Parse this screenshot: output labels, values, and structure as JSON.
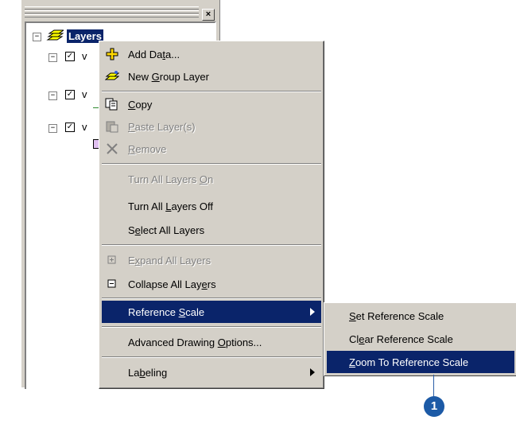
{
  "toc": {
    "close_glyph": "×",
    "root_label": "Layers",
    "root_expander": "−",
    "layers": [
      {
        "expander": "−",
        "check": "✓",
        "label": "v"
      },
      {
        "expander": "−",
        "check": "✓",
        "label": "v"
      },
      {
        "expander": "−",
        "check": "✓",
        "label": "v"
      }
    ]
  },
  "menu": {
    "items": [
      {
        "id": "add-data",
        "label_pre": "Add Da",
        "label_u": "t",
        "label_post": "a...",
        "icon": "add-data-icon",
        "disabled": false
      },
      {
        "id": "new-group-layer",
        "label_pre": "New ",
        "label_u": "G",
        "label_post": "roup Layer",
        "icon": "new-group-layer-icon",
        "disabled": false
      },
      {
        "id": "copy",
        "label_pre": "",
        "label_u": "C",
        "label_post": "opy",
        "icon": "copy-icon",
        "disabled": false
      },
      {
        "id": "paste-layers",
        "label_pre": "",
        "label_u": "P",
        "label_post": "aste Layer(s)",
        "icon": "paste-icon",
        "disabled": true
      },
      {
        "id": "remove",
        "label_pre": "",
        "label_u": "R",
        "label_post": "emove",
        "icon": "remove-icon",
        "disabled": true
      },
      {
        "id": "turn-all-layers-on",
        "label_pre": "Turn All Layers ",
        "label_u": "O",
        "label_post": "n",
        "disabled": true
      },
      {
        "id": "turn-all-layers-off",
        "label_pre": "Turn All ",
        "label_u": "L",
        "label_post": "ayers Off",
        "disabled": false
      },
      {
        "id": "select-all-layers",
        "label_pre": "S",
        "label_u": "e",
        "label_post": "lect All Layers",
        "disabled": false
      },
      {
        "id": "expand-all-layers",
        "label_pre": "E",
        "label_u": "x",
        "label_post": "pand All Layers",
        "icon": "expand-icon",
        "disabled": true
      },
      {
        "id": "collapse-all-layers",
        "label_pre": "Collapse All Lay",
        "label_u": "e",
        "label_post": "rs",
        "icon": "collapse-icon",
        "disabled": false
      },
      {
        "id": "reference-scale",
        "label_pre": "Reference ",
        "label_u": "S",
        "label_post": "cale",
        "highlighted": true,
        "submenu": true
      },
      {
        "id": "advanced-drawing-options",
        "label_pre": "Advanced Drawing ",
        "label_u": "O",
        "label_post": "ptions...",
        "disabled": false
      },
      {
        "id": "labeling",
        "label_pre": "La",
        "label_u": "b",
        "label_post": "eling",
        "submenu": true,
        "disabled": false
      }
    ]
  },
  "submenu": {
    "items": [
      {
        "id": "set-reference-scale",
        "label_pre": "",
        "label_u": "S",
        "label_post": "et Reference Scale"
      },
      {
        "id": "clear-reference-scale",
        "label_pre": "Cl",
        "label_u": "e",
        "label_post": "ar Reference Scale"
      },
      {
        "id": "zoom-to-reference-scale",
        "label_pre": "",
        "label_u": "Z",
        "label_post": "oom To Reference Scale",
        "highlighted": true
      }
    ]
  },
  "callout": {
    "number": "1",
    "color": "#1c5aa6"
  },
  "colors": {
    "highlight": "#0a246a",
    "face": "#d4d0c8",
    "disabled_text": "#808080"
  }
}
